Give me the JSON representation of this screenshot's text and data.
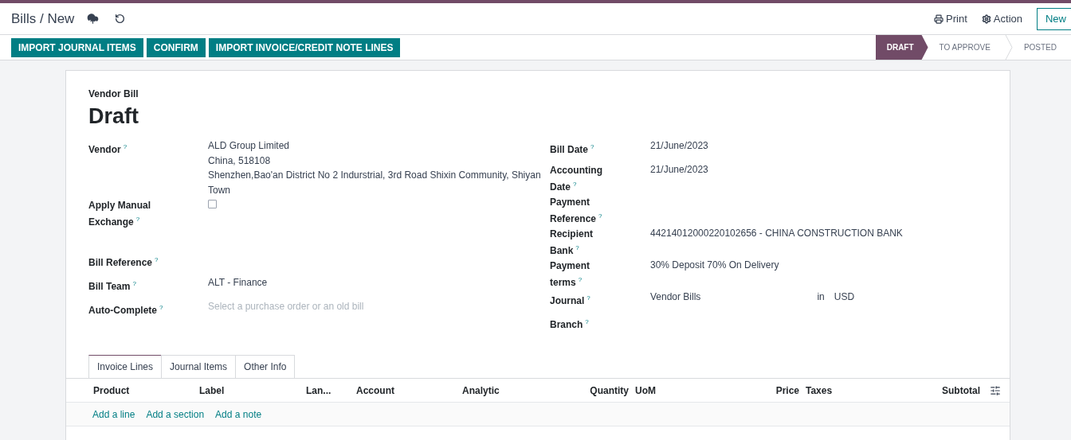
{
  "breadcrumb": {
    "parent": "Bills",
    "separator": "/",
    "current": "New"
  },
  "header_actions": [
    {
      "kind": "print",
      "label": "Print"
    },
    {
      "kind": "action",
      "label": "Action"
    }
  ],
  "new_button": "New",
  "action_buttons": [
    "IMPORT JOURNAL ITEMS",
    "CONFIRM",
    "IMPORT INVOICE/CREDIT NOTE LINES"
  ],
  "status_steps": [
    {
      "label": "DRAFT",
      "selected": true
    },
    {
      "label": "TO APPROVE",
      "selected": false
    },
    {
      "label": "POSTED",
      "selected": false
    }
  ],
  "form": {
    "subtitle": "Vendor Bill",
    "title": "Draft",
    "left_fields": [
      {
        "kind": "text",
        "label": "Vendor",
        "hint": "?",
        "lines": [
          "ALD Group Limited",
          "China, 518108",
          "Shenzhen,Bao'an District No 2 Indurstrial, 3rd Road Shixin Community, Shiyan Town"
        ]
      },
      {
        "kind": "checkbox",
        "label": "Apply Manual Exchange",
        "hint": "?",
        "checked": false
      },
      {
        "kind": "empty",
        "label": "Bill Reference",
        "hint": "?"
      },
      {
        "kind": "text",
        "label": "Bill Team",
        "hint": "?",
        "lines": [
          "ALT - Finance"
        ]
      },
      {
        "kind": "placeholder",
        "label": "Auto-Complete",
        "hint": "?",
        "placeholder": "Select a purchase order or an old bill"
      }
    ],
    "right_fields": [
      {
        "kind": "text",
        "label": "Bill Date",
        "hint": "?",
        "lines": [
          "21/June/2023"
        ]
      },
      {
        "kind": "text",
        "label": "Accounting Date",
        "hint": "?",
        "lines": [
          "21/June/2023"
        ]
      },
      {
        "kind": "empty",
        "label": "Payment Reference",
        "hint": "?"
      },
      {
        "kind": "text",
        "label": "Recipient Bank",
        "hint": "?",
        "lines": [
          "44214012000220102656 - CHINA CONSTRUCTION BANK"
        ]
      },
      {
        "kind": "text",
        "label": "Payment terms",
        "hint": "?",
        "lines": [
          "30% Deposit 70% On Delivery"
        ]
      },
      {
        "kind": "journal",
        "label": "Journal",
        "hint": "?",
        "value": "Vendor Bills",
        "connector": "in",
        "currency": "USD"
      },
      {
        "kind": "empty",
        "label": "Branch",
        "hint": "?"
      }
    ]
  },
  "tabs": [
    {
      "label": "Invoice Lines",
      "selected": true
    },
    {
      "label": "Journal Items",
      "selected": false
    },
    {
      "label": "Other Info",
      "selected": false
    }
  ],
  "table": {
    "columns": [
      "Product",
      "Label",
      "Lan...",
      "Account",
      "Analytic",
      "Quantity",
      "UoM",
      "Price",
      "Taxes",
      "Subtotal"
    ],
    "add_links": [
      "Add a line",
      "Add a section",
      "Add a note"
    ]
  }
}
